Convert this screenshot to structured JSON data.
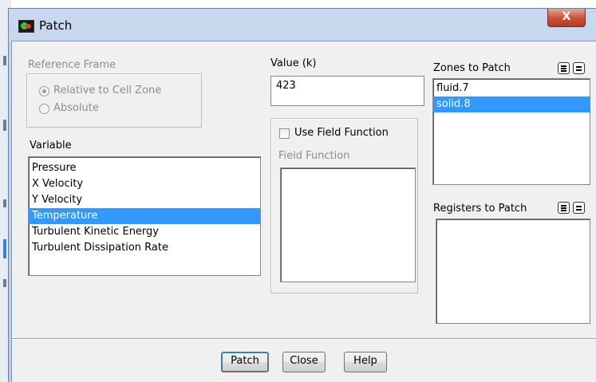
{
  "window": {
    "title": "Patch",
    "close_label": "X"
  },
  "reference_frame": {
    "label": "Reference Frame",
    "options": [
      {
        "label": "Relative to Cell Zone",
        "selected": true
      },
      {
        "label": "Absolute",
        "selected": false
      }
    ]
  },
  "variable": {
    "label": "Variable",
    "items": [
      {
        "label": "Pressure",
        "selected": false
      },
      {
        "label": "X Velocity",
        "selected": false
      },
      {
        "label": "Y Velocity",
        "selected": false
      },
      {
        "label": "Temperature",
        "selected": true
      },
      {
        "label": "Turbulent Kinetic Energy",
        "selected": false
      },
      {
        "label": "Turbulent Dissipation Rate",
        "selected": false
      }
    ]
  },
  "value": {
    "label": "Value (k)",
    "input": "423"
  },
  "field_function": {
    "checkbox_label": "Use Field Function",
    "checked": false,
    "list_label": "Field Function"
  },
  "zones": {
    "label": "Zones to Patch",
    "items": [
      {
        "label": "fluid.7",
        "selected": false
      },
      {
        "label": "solid.8",
        "selected": true
      }
    ]
  },
  "registers": {
    "label": "Registers to Patch",
    "items": []
  },
  "buttons": {
    "patch": "Patch",
    "close": "Close",
    "help": "Help"
  },
  "colors": {
    "selection": "#3399ff",
    "title_bar": "#c9d8ee",
    "close_button": "#c7503a"
  }
}
